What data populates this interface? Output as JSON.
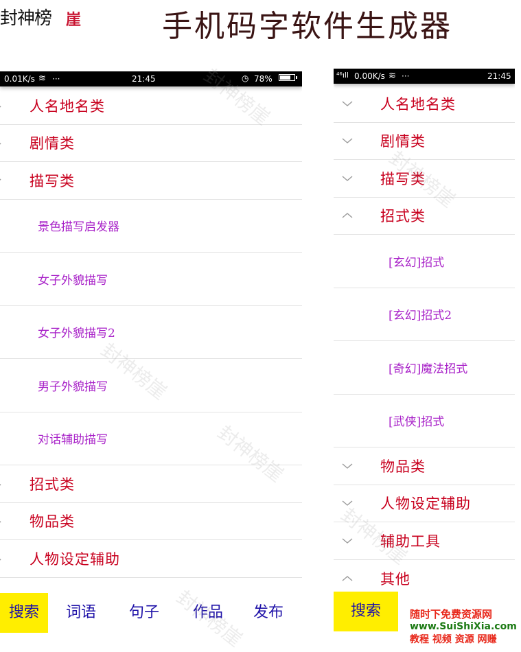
{
  "header": {
    "logo_text": "封神榜",
    "seal_text": "崖",
    "title": "手机码字软件生成器"
  },
  "left_phone": {
    "status": {
      "speed": "0.01K/s",
      "dots": "···",
      "time": "21:45",
      "battery": "78%"
    },
    "categories_top": [
      {
        "label": "人名地名类",
        "state": "collapsed"
      },
      {
        "label": "剧情类",
        "state": "collapsed"
      },
      {
        "label": "描写类",
        "state": "expanded"
      }
    ],
    "subitems": [
      {
        "label": "景色描写启发器"
      },
      {
        "label": "女子外貌描写"
      },
      {
        "label": "女子外貌描写2"
      },
      {
        "label": "男子外貌描写"
      },
      {
        "label": "对话辅助描写"
      }
    ],
    "categories_bottom": [
      {
        "label": "招式类"
      },
      {
        "label": "物品类"
      },
      {
        "label": "人物设定辅助"
      }
    ],
    "bottom_nav": [
      "搜索",
      "词语",
      "句子",
      "作品",
      "发布"
    ]
  },
  "right_phone": {
    "status": {
      "signal": "⁴⁶ıll",
      "speed": "0.00K/s",
      "dots": "···",
      "time": "21:45"
    },
    "categories_top": [
      {
        "label": "人名地名类",
        "state": "collapsed"
      },
      {
        "label": "剧情类",
        "state": "collapsed"
      },
      {
        "label": "描写类",
        "state": "collapsed"
      },
      {
        "label": "招式类",
        "state": "expanded"
      }
    ],
    "subitems": [
      {
        "label": "[玄幻]招式"
      },
      {
        "label": "[玄幻]招式2"
      },
      {
        "label": "[奇幻]魔法招式"
      },
      {
        "label": "[武侠]招式"
      }
    ],
    "categories_bottom": [
      {
        "label": "物品类",
        "state": "collapsed"
      },
      {
        "label": "人物设定辅助",
        "state": "collapsed"
      },
      {
        "label": "辅助工具",
        "state": "collapsed"
      },
      {
        "label": "其他",
        "state": "expanded"
      }
    ],
    "bottom_nav": [
      "搜索"
    ]
  },
  "watermark_text": "封神榜崖",
  "corner_watermark": {
    "line1": "随时下免费资源网",
    "line2": "www.SuiShiXia.com",
    "line3": "教程 视频 资源 网赚"
  },
  "colors": {
    "category_text": "#c8001e",
    "subitem_text": "#a821c8",
    "nav_text": "#1f12a8",
    "nav_active_bg": "#ffee00",
    "title_text": "#3a1414"
  }
}
